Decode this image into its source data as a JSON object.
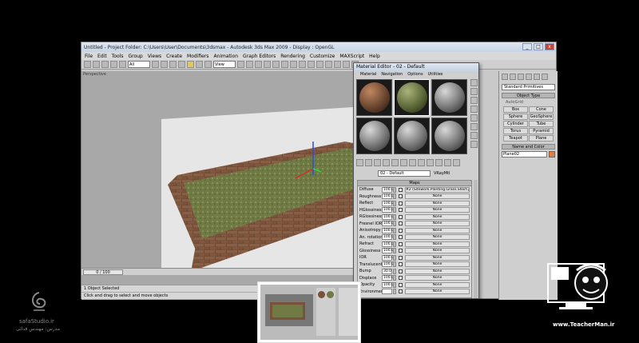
{
  "app": {
    "title": "Untitled    - Project Folder: C:\\Users\\User\\Documents\\3dsmax    - Autodesk 3ds Max 2009    - Display : OpenGL",
    "window_buttons": [
      "_",
      "□",
      "x"
    ],
    "menu": [
      "File",
      "Edit",
      "Tools",
      "Group",
      "Views",
      "Create",
      "Modifiers",
      "Animation",
      "Graph Editors",
      "Rendering",
      "Customize",
      "MAXScript",
      "Help"
    ],
    "toolbar": {
      "selection_filter": "All",
      "ref_coord": "View"
    }
  },
  "viewport": {
    "label": "Perspective",
    "time_slider": "0 / 100",
    "status_selected": "1 Object Selected",
    "status_prompt": "Click and drag to select and move objects"
  },
  "command_panel": {
    "category": "Standard Primitives",
    "object_type_rollout": "Object Type",
    "autogrid": "AutoGrid",
    "buttons": [
      "Box",
      "Cone",
      "Sphere",
      "GeoSphere",
      "Cylinder",
      "Tube",
      "Torus",
      "Pyramid",
      "Teapot",
      "Plane"
    ],
    "name_color_rollout": "Name and Color",
    "object_name": "Plane02",
    "object_color": "#e67e3a"
  },
  "material_editor": {
    "title": "Material Editor - 02 - Default",
    "menu": [
      "Material",
      "Navigation",
      "Options",
      "Utilities"
    ],
    "material_name": "02 - Default",
    "material_type": "VRayMtl",
    "maps_rollout": "Maps",
    "maps": [
      {
        "label": "Diffuse",
        "value": "100.0",
        "map": "#2 (Sitework.Planting.Grass.Short.jpg)"
      },
      {
        "label": "Roughness",
        "value": "100.0",
        "map": "None"
      },
      {
        "label": "Reflect",
        "value": "100.0",
        "map": "None"
      },
      {
        "label": "HGlossiness",
        "value": "100.0",
        "map": "None"
      },
      {
        "label": "RGlossiness",
        "value": "100.0",
        "map": "None"
      },
      {
        "label": "Fresnel IOR",
        "value": "100.0",
        "map": "None"
      },
      {
        "label": "Anisotropy",
        "value": "100.0",
        "map": "None"
      },
      {
        "label": "An. rotation",
        "value": "100.0",
        "map": "None"
      },
      {
        "label": "Refract",
        "value": "100.0",
        "map": "None"
      },
      {
        "label": "Glossiness",
        "value": "100.0",
        "map": "None"
      },
      {
        "label": "IOR",
        "value": "100.0",
        "map": "None"
      },
      {
        "label": "Translucent",
        "value": "100.0",
        "map": "None"
      },
      {
        "label": "Bump",
        "value": "30.0",
        "map": "None"
      },
      {
        "label": "Displace",
        "value": "100.0",
        "map": "None"
      },
      {
        "label": "Opacity",
        "value": "100.0",
        "map": "None"
      },
      {
        "label": "Environment",
        "value": "",
        "map": "None"
      }
    ]
  },
  "watermarks": {
    "left_name": "safaStudio.ir",
    "left_sub": "مدرس: مهندس فدائی",
    "right_url": "www.TeacherMan.ir"
  }
}
